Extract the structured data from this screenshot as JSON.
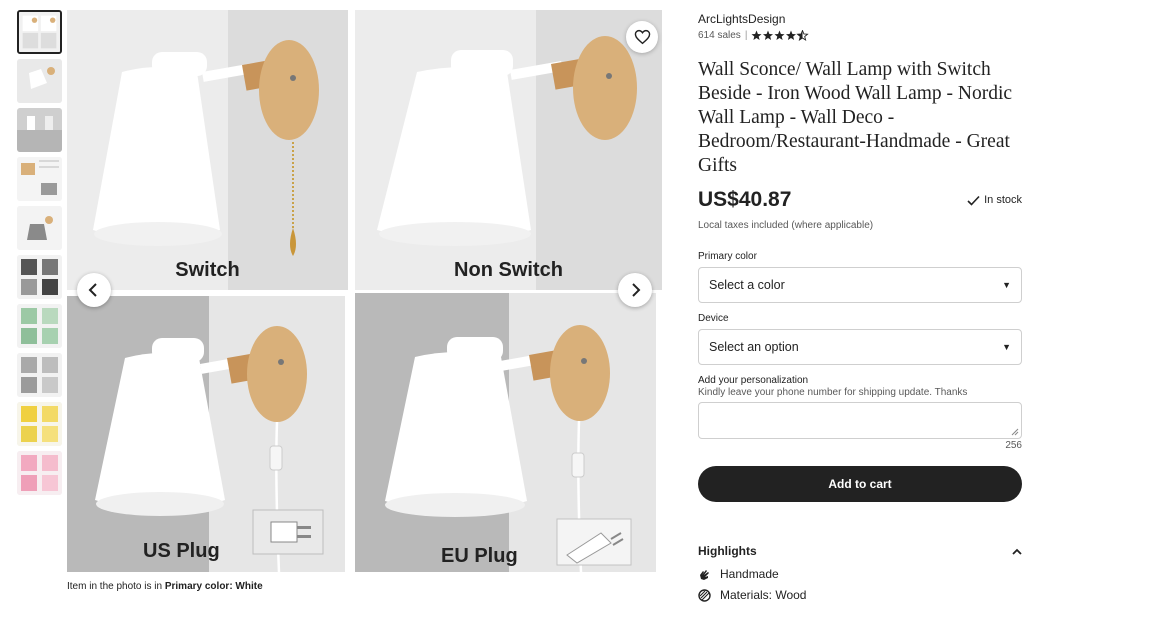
{
  "thumbnails": [
    {
      "name": "thumb-1",
      "active": true
    },
    {
      "name": "thumb-2",
      "active": false
    },
    {
      "name": "thumb-3",
      "active": false
    },
    {
      "name": "thumb-4",
      "active": false
    },
    {
      "name": "thumb-5",
      "active": false
    },
    {
      "name": "thumb-6",
      "active": false
    },
    {
      "name": "thumb-7",
      "active": false
    },
    {
      "name": "thumb-8",
      "active": false
    },
    {
      "name": "thumb-9",
      "active": false
    },
    {
      "name": "thumb-10",
      "active": false
    }
  ],
  "main_image": {
    "labels": {
      "switch": "Switch",
      "non_switch": "Non Switch",
      "us_plug": "US Plug",
      "eu_plug": "EU Plug"
    }
  },
  "caption": {
    "prefix": "Item in the photo is in ",
    "value": "Primary color: White"
  },
  "shop": {
    "name": "ArcLightsDesign",
    "sales": "614 sales",
    "rating": 4.5
  },
  "product": {
    "title": "Wall Sconce/ Wall Lamp with Switch Beside - Iron Wood Wall Lamp - Nordic Wall Lamp - Wall Deco - Bedroom/Restaurant-Handmade - Great Gifts",
    "price": "US$40.87",
    "stock": "In stock",
    "taxes": "Local taxes included (where applicable)"
  },
  "options": {
    "primary_color": {
      "label": "Primary color",
      "value": "Select a color"
    },
    "device": {
      "label": "Device",
      "value": "Select an option"
    }
  },
  "personalization": {
    "label": "Add your personalization",
    "hint": "Kindly leave your phone number for shipping update. Thanks",
    "counter": "256"
  },
  "cart": {
    "label": "Add to cart"
  },
  "highlights": {
    "title": "Highlights",
    "items": [
      "Handmade",
      "Materials: Wood"
    ]
  },
  "colors": {
    "button_dark": "#222222",
    "wood": "#d9b07a",
    "lamp_white": "#ffffff"
  }
}
